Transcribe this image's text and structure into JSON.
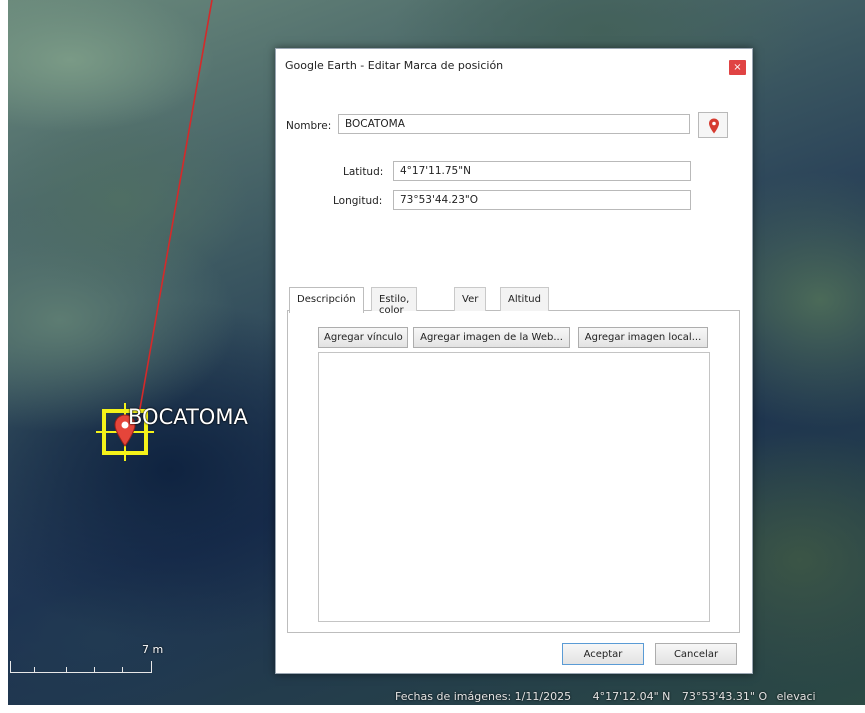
{
  "map": {
    "placemark_label": "BOCATOMA",
    "scale_label": "7 m",
    "status": {
      "imagery_date": "Fechas de imágenes: 1/11/2025",
      "latitude": "4°17'12.04\" N",
      "longitude": "73°53'43.31\" O",
      "elevation_fragment": "elevaci"
    }
  },
  "dialog": {
    "title": "Google Earth - Editar Marca de posición",
    "close_glyph": "×",
    "name_label": "Nombre:",
    "name_value": "BOCATOMA",
    "latitude_label": "Latitud:",
    "latitude_value": "4°17'11.75\"N",
    "longitude_label": "Longitud:",
    "longitude_value": "73°53'44.23\"O",
    "tabs": [
      {
        "label": "Descripción",
        "active": true
      },
      {
        "label": "Estilo, color",
        "active": false
      },
      {
        "label": "Ver",
        "active": false
      },
      {
        "label": "Altitud",
        "active": false
      }
    ],
    "description_buttons": {
      "add_link": "Agregar vínculo",
      "add_web_image": "Agregar imagen de la Web...",
      "add_local_image": "Agregar imagen local..."
    },
    "description_value": "",
    "ok_label": "Aceptar",
    "cancel_label": "Cancelar"
  },
  "colors": {
    "pin": "#e5453a",
    "highlight": "#f4f21a",
    "sight_line": "#d42a2a"
  },
  "icons": [
    "placemark-pin-icon",
    "close-icon",
    "pin-style-icon"
  ]
}
